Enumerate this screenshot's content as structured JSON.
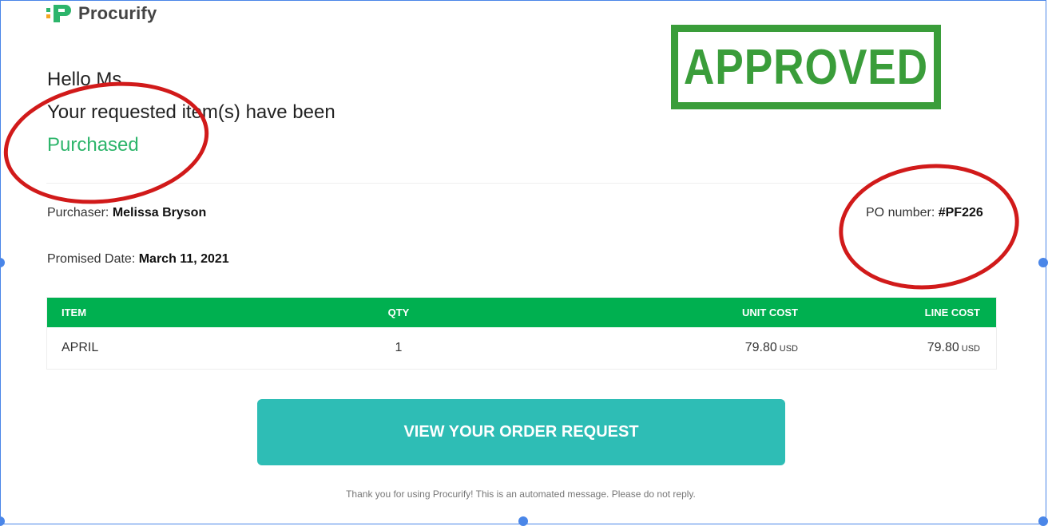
{
  "brand": {
    "name": "Procurify",
    "color": "#00b050"
  },
  "stamp": {
    "text": "APPROVED",
    "color": "#3a9d3a"
  },
  "greeting": {
    "line1": "Hello Ms.",
    "line2": "Your requested item(s) have been",
    "status": "Purchased"
  },
  "meta": {
    "purchaser_label": "Purchaser:",
    "purchaser_value": "Melissa Bryson",
    "promised_label": "Promised Date:",
    "promised_value": "March 11, 2021",
    "po_label": "PO number:",
    "po_value": "#PF226"
  },
  "table": {
    "headers": {
      "item": "ITEM",
      "qty": "QTY",
      "unit_cost": "UNIT COST",
      "line_cost": "LINE COST"
    },
    "rows": [
      {
        "item": "APRIL",
        "qty": "1",
        "unit_cost": "79.80",
        "unit_currency": "USD",
        "line_cost": "79.80",
        "line_currency": "USD"
      }
    ]
  },
  "button": {
    "label": "VIEW YOUR ORDER REQUEST",
    "color": "#2ebdb5"
  },
  "footer": {
    "text": "Thank you for using Procurify! This is an automated message. Please do not reply."
  },
  "annotations": {
    "circle_color": "#d11a1a"
  }
}
